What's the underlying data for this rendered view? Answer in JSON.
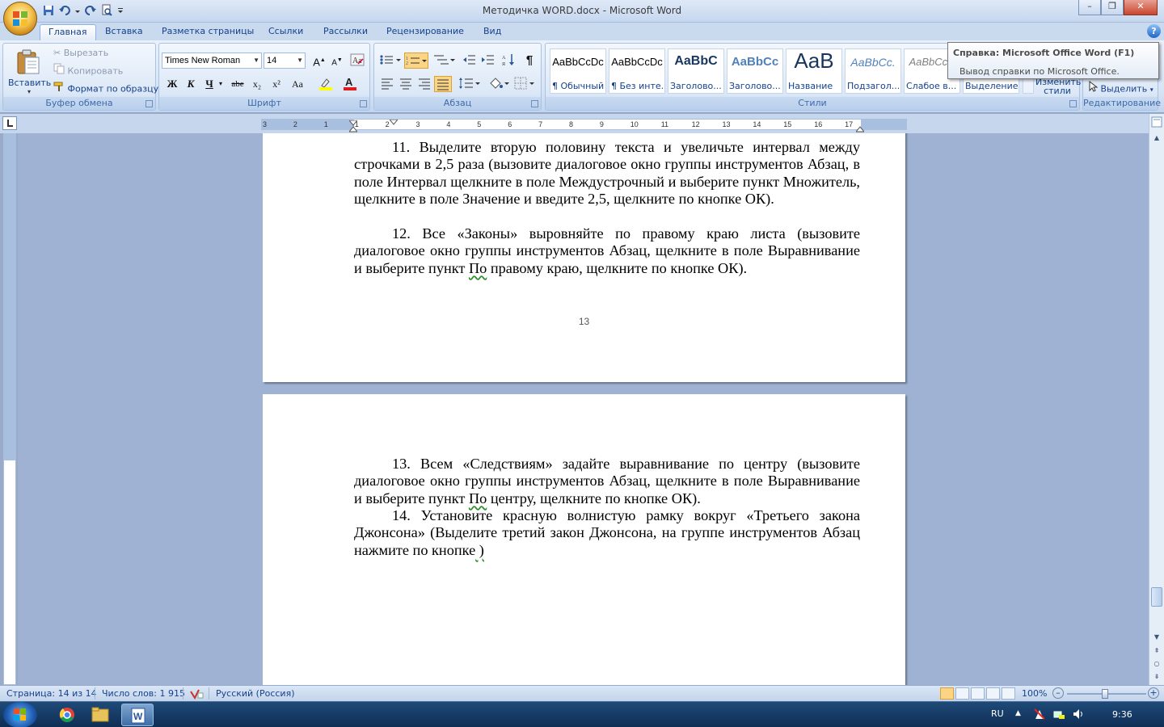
{
  "window": {
    "title": "Методичка WORD.docx - Microsoft Word",
    "controls": {
      "minimize": "–",
      "maximize": "❐",
      "close": "✕"
    }
  },
  "tabs": [
    "Главная",
    "Вставка",
    "Разметка страницы",
    "Ссылки",
    "Рассылки",
    "Рецензирование",
    "Вид"
  ],
  "active_tab": "Главная",
  "clipboard": {
    "paste": "Вставить",
    "cut": "Вырезать",
    "copy": "Копировать",
    "format_painter": "Формат по образцу",
    "label": "Буфер обмена"
  },
  "font": {
    "name": "Times New Roman",
    "size": "14",
    "label": "Шрифт",
    "bold": "Ж",
    "italic": "К",
    "underline": "Ч",
    "strike": "abe",
    "subscript": "x₂",
    "superscript": "x²",
    "change_case": "Aa",
    "grow": "A",
    "shrink": "A"
  },
  "paragraph": {
    "label": "Абзац",
    "pilcrow": "¶"
  },
  "styles": {
    "label": "Стили",
    "items": [
      {
        "sample": "AaBbCcDc",
        "name": "¶ Обычный"
      },
      {
        "sample": "AaBbCcDc",
        "name": "¶ Без инте..."
      },
      {
        "sample": "AaBbC",
        "name": "Заголово..."
      },
      {
        "sample": "AaBbCc",
        "name": "Заголово..."
      },
      {
        "sample": "AaB",
        "name": "Название"
      },
      {
        "sample": "AaBbCc.",
        "name": "Подзагол..."
      },
      {
        "sample": "AaBbCcD",
        "name": "Слабое в..."
      },
      {
        "sample": "",
        "name": "Выделение"
      }
    ],
    "change_styles": "Изменить стили"
  },
  "editing": {
    "label": "Редактирование",
    "select": "Выделить"
  },
  "tooltip": {
    "title": "Справка: Microsoft Office Word (F1)",
    "body": "Вывод справки по Microsoft Office."
  },
  "ruler": {
    "ticks": [
      "3",
      "2",
      "1",
      "1",
      "2",
      "3",
      "4",
      "5",
      "6",
      "7",
      "8",
      "9",
      "10",
      "11",
      "12",
      "13",
      "14",
      "15",
      "16",
      "17"
    ]
  },
  "document": {
    "page1": {
      "p11_num": "11.",
      "p11": "Выделите вторую половину текста и увеличьте интервал между строчками в 2,5 раза (вызовите диалоговое окно группы инструментов Абзац, в поле  Интервал щелкните в поле Междустрочный и выберите пункт Множитель, щелкните в поле Значение и введите 2,5, щелкните по кнопке ОК).",
      "p12_num": "12.",
      "p12_a": "Все «Законы» выровняйте по правому краю листа (вызовите диалоговое окно группы инструментов Абзац, щелкните в поле Выравнивание и выберите пункт ",
      "p12_b": "По",
      "p12_c": " правому краю, щелкните по кнопке ОК).",
      "page_number": "13"
    },
    "page2": {
      "p13_num": "13.",
      "p13_a": "Всем «Следствиям» задайте выравнивание по центру (вызовите диалоговое окно группы инструментов Абзац, щелкните в поле Выравнивание и выберите пункт ",
      "p13_b": "По",
      "p13_c": " центру, щелкните по кнопке ОК).",
      "p14_num": "14.",
      "p14_a": "Установите красную волнистую рамку вокруг «Третьего закона Джонсона» (Выделите третий закон Джонсона, на группе инструментов Абзац нажмите по кнопке",
      "p14_b": " )"
    }
  },
  "status": {
    "page": "Страница: 14 из 14",
    "words": "Число слов: 1 915",
    "language": "Русский (Россия)",
    "zoom": "100%"
  },
  "taskbar": {
    "lang": "RU",
    "time": "9:36"
  },
  "colors": {
    "ribbon_text": "#15428b",
    "tab_bar": "#c9d9ee",
    "doc_background": "#9fb2d3"
  }
}
